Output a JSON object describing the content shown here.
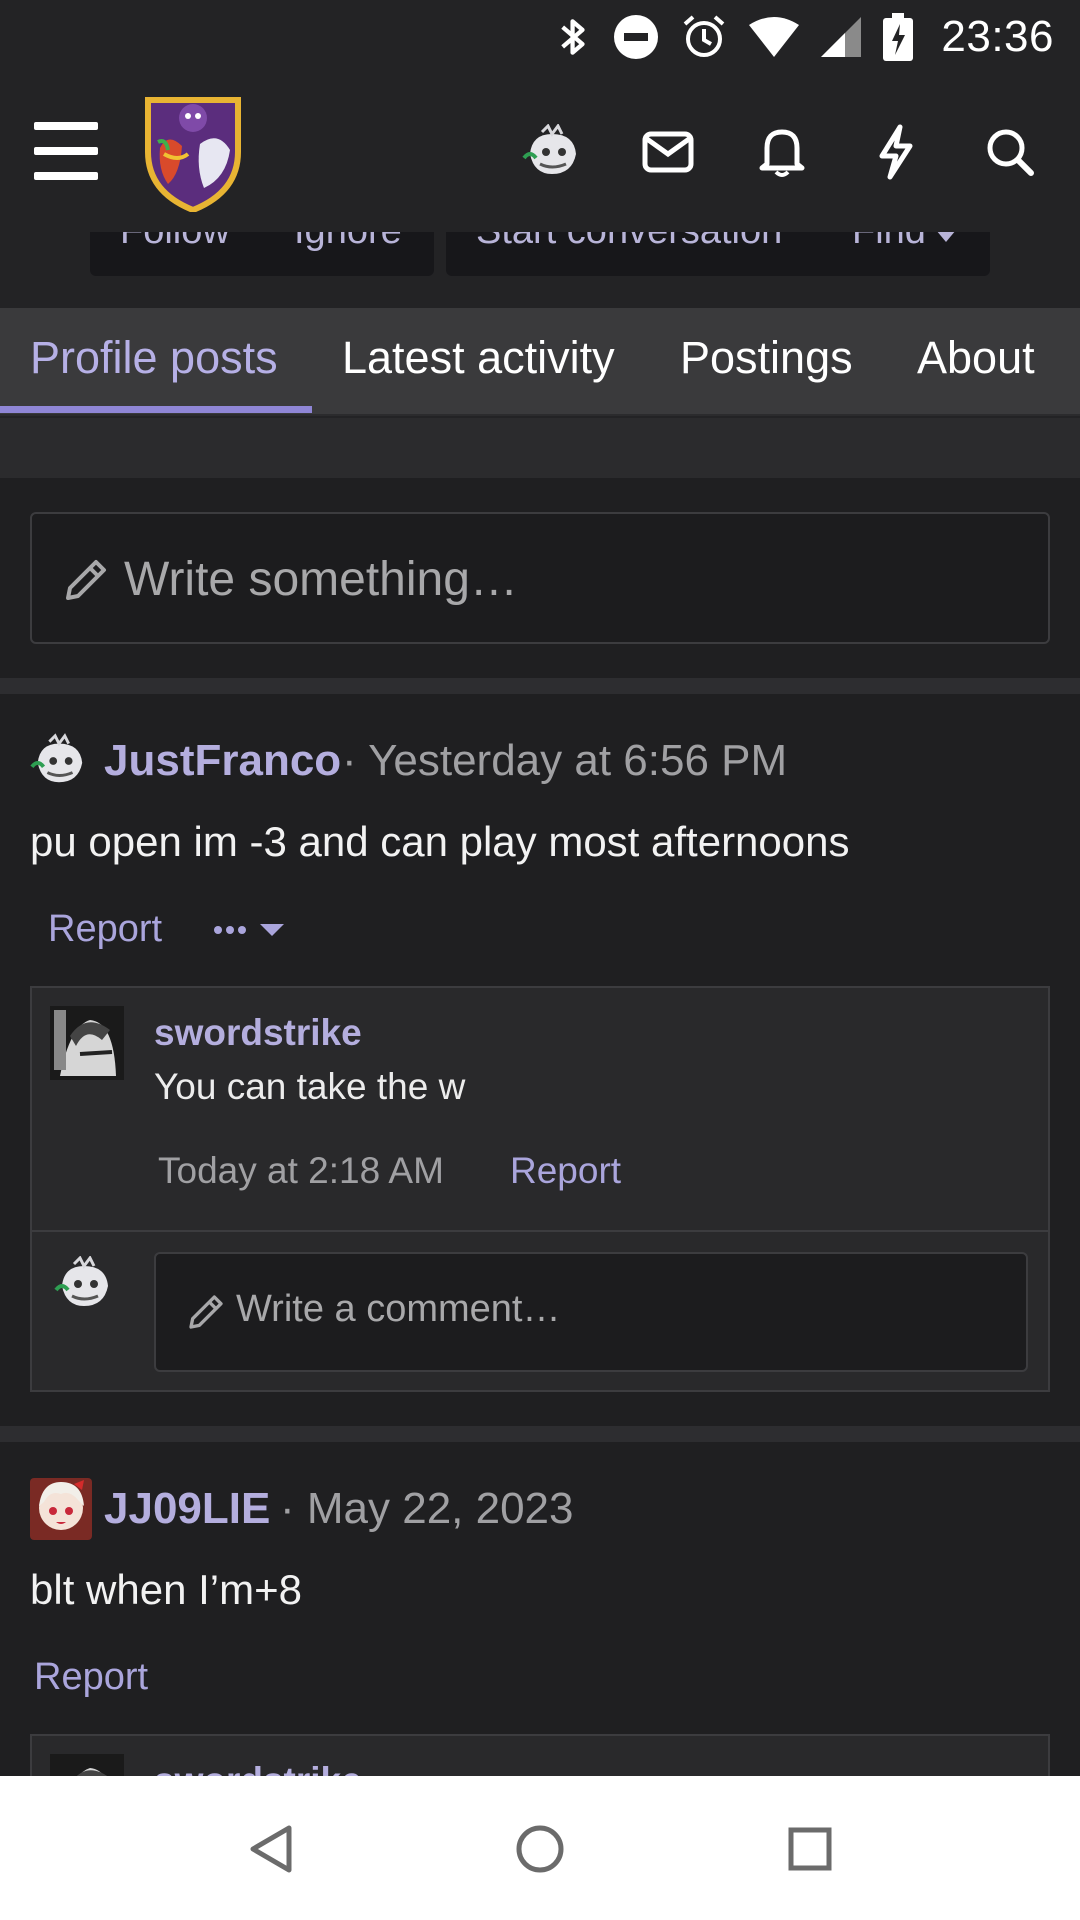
{
  "status_bar": {
    "time": "23:36",
    "icons": [
      "bluetooth-icon",
      "do-not-disturb-icon",
      "alarm-icon",
      "wifi-icon",
      "cell-signal-icon",
      "battery-charging-icon"
    ]
  },
  "header": {
    "icons": [
      "menu-icon",
      "forum-logo",
      "user-avatar",
      "mail-icon",
      "bell-icon",
      "bolt-icon",
      "search-icon"
    ]
  },
  "profile_actions": {
    "follow": "Follow",
    "ignore": "Ignore",
    "start_conversation": "Start conversation",
    "find": "Find"
  },
  "tabs": [
    {
      "label": "Profile posts",
      "active": true
    },
    {
      "label": "Latest activity",
      "active": false
    },
    {
      "label": "Postings",
      "active": false
    },
    {
      "label": "About",
      "active": false
    }
  ],
  "composer": {
    "placeholder": "Write something…"
  },
  "posts": [
    {
      "author": "JustFranco",
      "time": "· Yesterday at 6:56 PM",
      "body": "pu open im -3 and can play most afternoons",
      "report": "Report",
      "comments": [
        {
          "author": "swordstrike",
          "text": "You can take the w",
          "time": "Today at 2:18 AM",
          "report": "Report"
        }
      ],
      "comment_placeholder": "Write a comment…"
    },
    {
      "author": "JJ09LIE",
      "time": "· May 22, 2023",
      "body": "blt when I’m+8",
      "report": "Report",
      "comments": [
        {
          "author": "swordstrike"
        }
      ]
    }
  ],
  "colors": {
    "accent": "#b4aede",
    "tab_underline": "#8f86d6",
    "background": "#1f1f21"
  }
}
